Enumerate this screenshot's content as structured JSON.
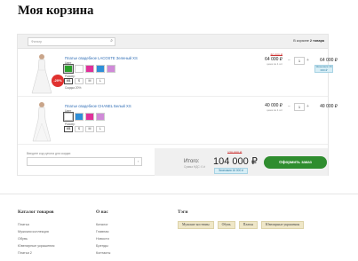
{
  "page_title": "Моя корзина",
  "filter_placeholder": "Фильтр",
  "cart_count": {
    "prefix": "В корзине",
    "value": "2 товара"
  },
  "items": [
    {
      "name": "Платье свадебное LACOSTE Зеленый XS",
      "discount_badge": "-20%",
      "color_label": "Цвет",
      "colors": [
        "#2aa02a",
        "#ffffff",
        "#e0309a",
        "#2e8fd8",
        "#d08ad8"
      ],
      "size_label": "Размер",
      "sizes": [
        "XS",
        "S",
        "M",
        "L"
      ],
      "selected_size": "XS",
      "discount_text": "Скидка 20%",
      "old_price": "80 000 ₽",
      "price": "64 000 ₽",
      "unit_price": "цена за 1 шт",
      "qty": "1",
      "total": "64 000 ₽",
      "saving": "Экономия 16 000 ₽"
    },
    {
      "name": "Платье свадебное CHANEL Белый XS",
      "color_label": "Цвет",
      "colors": [
        "#ffffff",
        "#2e8fd8",
        "#e0309a",
        "#d08ad8"
      ],
      "size_label": "Размер",
      "sizes": [
        "XS",
        "S",
        "M",
        "L"
      ],
      "selected_size": "XS",
      "price": "40 000 ₽",
      "unit_price": "цена за 1 шт",
      "qty": "1",
      "total": "40 000 ₽"
    }
  ],
  "coupon": {
    "label": "Введите код купона для скидки:",
    "button": "›"
  },
  "summary": {
    "label": "Итого:",
    "nds": "Сумма НДС: 0 ₽",
    "old_total": "120 000 ₽",
    "total": "104 000 ₽",
    "saving": "Экономия 16 000 ₽",
    "checkout": "Оформить заказ"
  },
  "footer": {
    "catalog": {
      "title": "Каталог товаров",
      "items": [
        "Платья",
        "Мужская коллекция",
        "Обувь",
        "Ювелирные украшения",
        "Платья 2"
      ]
    },
    "about": {
      "title": "О нас",
      "items": [
        "Каталог",
        "Главная",
        "Новости",
        "Бренды",
        "Контакты"
      ]
    },
    "tags": {
      "title": "Тэги",
      "items": [
        "Мужские костюмы",
        "Обувь",
        "Платья",
        "Ювелирные украшения"
      ]
    }
  },
  "colors": {
    "accent": "#2f8d2f",
    "price_old": "#cc3333",
    "link": "#2f6db5",
    "badge": "#e0312f"
  }
}
